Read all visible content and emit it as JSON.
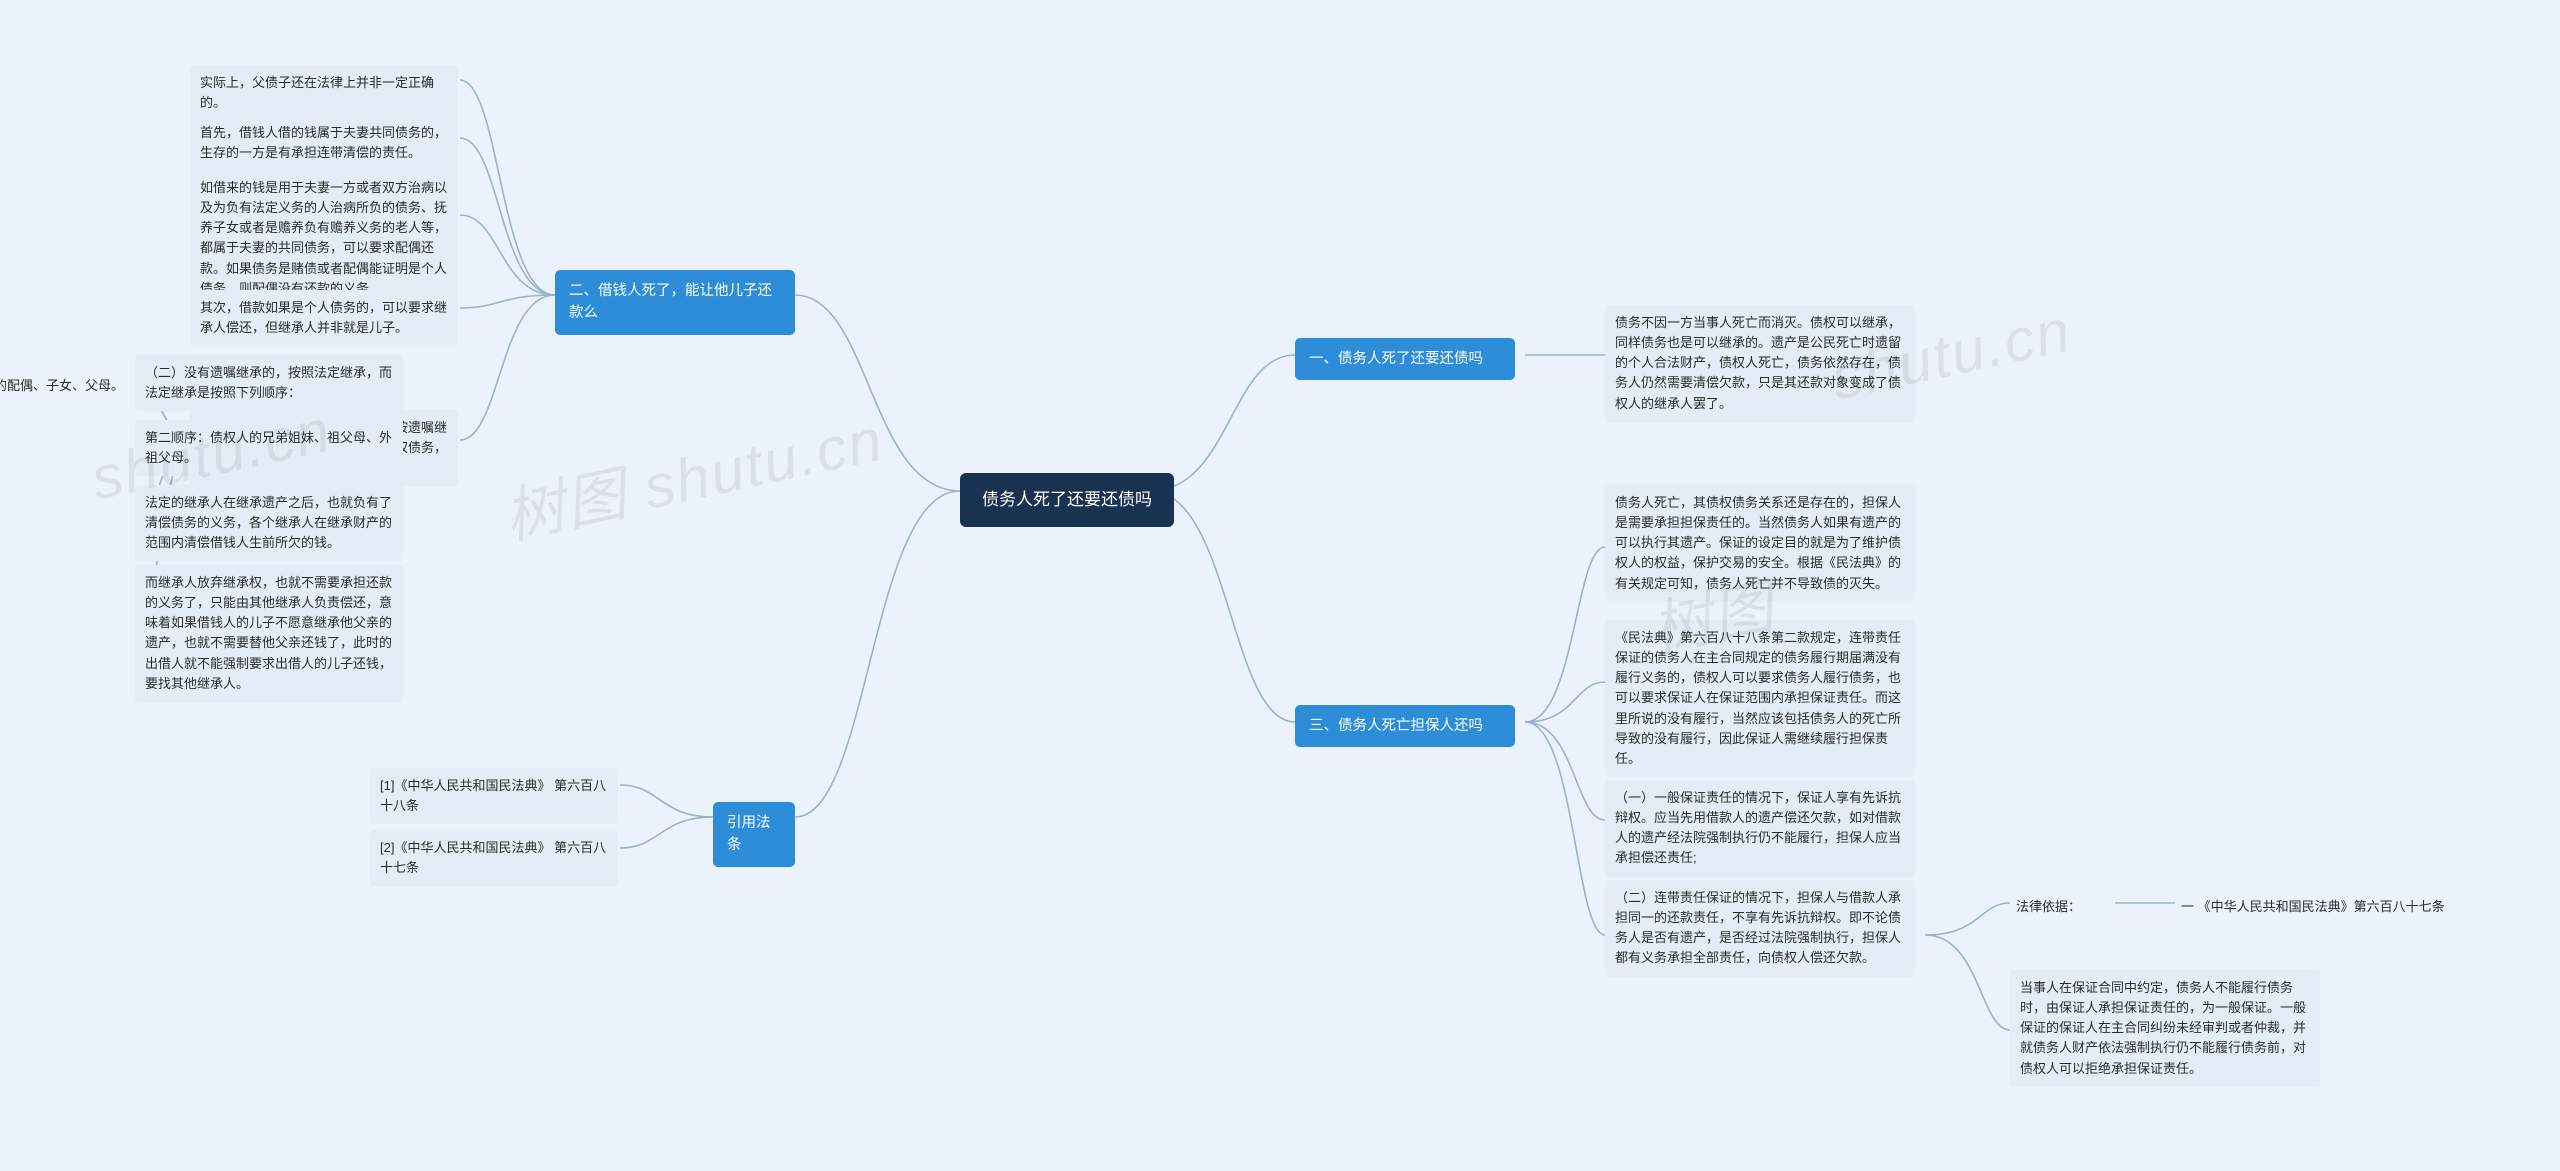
{
  "root": "债务人死了还要还债吗",
  "right": {
    "b1": {
      "title": "一、债务人死了还要还债吗",
      "l1": "债务不因一方当事人死亡而消灭。债权可以继承，同样债务也是可以继承的。遗产是公民死亡时遗留的个人合法财产，债权人死亡，债务依然存在，债务人仍然需要清偿欠款，只是其还款对象变成了债权人的继承人罢了。"
    },
    "b3": {
      "title": "三、债务人死亡担保人还吗",
      "l1": "债务人死亡，其债权债务关系还是存在的，担保人是需要承担担保责任的。当然债务人如果有遗产的可以执行其遗产。保证的设定目的就是为了维护债权人的权益，保护交易的安全。根据《民法典》的有关规定可知，债务人死亡并不导致债的灭失。",
      "l2": "《民法典》第六百八十八条第二款规定，连带责任保证的债务人在主合同规定的债务履行期届满没有履行义务的，债权人可以要求债务人履行债务，也可以要求保证人在保证范围内承担保证责任。而这里所说的没有履行，当然应该包括债务人的死亡所导致的没有履行，因此保证人需继续履行担保责任。",
      "l3": "（一）一般保证责任的情况下，保证人享有先诉抗辩权。应当先用借款人的遗产偿还欠款，如对借款人的遗产经法院强制执行仍不能履行，担保人应当承担偿还责任;",
      "l4": "（二）连带责任保证的情况下，担保人与借款人承担同一的还款责任，不享有先诉抗辩权。即不论债务人是否有遗产，是否经过法院强制执行，担保人都有义务承担全部责任，向债权人偿还欠款。",
      "l4c1_label": "法律依据：",
      "l4c1": "一 《中华人民共和国民法典》第六百八十七条",
      "l4c2": "当事人在保证合同中约定，债务人不能履行债务时，由保证人承担保证责任的，为一般保证。一般保证的保证人在主合同纠纷未经审判或者仲裁，并就债务人财产依法强制执行仍不能履行债务前，对债权人可以拒绝承担保证责任。"
    }
  },
  "left": {
    "b2": {
      "title": "二、借钱人死了，能让他儿子还款么",
      "l1": "实际上，父债子还在法律上并非一定正确的。",
      "l2": "首先，借钱人借的钱属于夫妻共同债务的，生存的一方是有承担连带清偿的责任。",
      "l3": "如借来的钱是用于夫妻一方或者双方治病以及为负有法定义务的人治病所负的债务、抚养子女或者是赡养负有赡养义务的老人等，都属于夫妻的共同债务，可以要求配偶还款。如果债务是赌债或者配偶能证明是个人债务，则配偶没有还款的义务。",
      "l4": "其次，借款如果是个人债务的，可以要求继承人偿还，但继承人并非就是儿子。",
      "l5": {
        "text": "（一）借钱人死亡的，留有遗嘱先按遗嘱继承，遗嘱的继承人就概括继承了债权债务，需要把借款人所欠的钱还上。",
        "sub1": "（二）没有遗嘱继承的，按照法定继承，而法定继承是按照下列顺序：",
        "sub1c": "第一顺序：债权人的配偶、子女、父母。",
        "sub2": "第二顺序：债权人的兄弟姐妹、祖父母、外祖父母。",
        "sub3": "法定的继承人在继承遗产之后，也就负有了清偿债务的义务，各个继承人在继承财产的范围内清偿借钱人生前所欠的钱。",
        "sub4": "而继承人放弃继承权，也就不需要承担还款的义务了，只能由其他继承人负责偿还，意味着如果借钱人的儿子不愿意继承他父亲的遗产，也就不需要替他父亲还钱了，此时的出借人就不能强制要求出借人的儿子还钱，要找其他继承人。"
      }
    },
    "bRef": {
      "title": "引用法条",
      "l1": "[1]《中华人民共和国民法典》 第六百八十八条",
      "l2": "[2]《中华人民共和国民法典》 第六百八十七条"
    }
  },
  "watermarks": [
    "shutu.cn",
    "树图 shutu.cn",
    "shutu.cn",
    "树图"
  ],
  "chart_data": {
    "type": "mindmap",
    "root": "债务人死了还要还债吗",
    "children": [
      {
        "side": "right",
        "label": "一、债务人死了还要还债吗",
        "children": [
          {
            "label": "债务不因一方当事人死亡而消灭。债权可以继承，同样债务也是可以继承的。遗产是公民死亡时遗留的个人合法财产，债权人死亡，债务依然存在，债务人仍然需要清偿欠款，只是其还款对象变成了债权人的继承人罢了。"
          }
        ]
      },
      {
        "side": "right",
        "label": "三、债务人死亡担保人还吗",
        "children": [
          {
            "label": "债务人死亡，其债权债务关系还是存在的，担保人是需要承担担保责任的。当然债务人如果有遗产的可以执行其遗产。保证的设定目的就是为了维护债权人的权益，保护交易的安全。根据《民法典》的有关规定可知，债务人死亡并不导致债的灭失。"
          },
          {
            "label": "《民法典》第六百八十八条第二款规定，连带责任保证的债务人在主合同规定的债务履行期届满没有履行义务的，债权人可以要求债务人履行债务，也可以要求保证人在保证范围内承担保证责任。而这里所说的没有履行，当然应该包括债务人的死亡所导致的没有履行，因此保证人需继续履行担保责任。"
          },
          {
            "label": "（一）一般保证责任的情况下，保证人享有先诉抗辩权。应当先用借款人的遗产偿还欠款，如对借款人的遗产经法院强制执行仍不能履行，担保人应当承担偿还责任;"
          },
          {
            "label": "（二）连带责任保证的情况下，担保人与借款人承担同一的还款责任，不享有先诉抗辩权。即不论债务人是否有遗产，是否经过法院强制执行，担保人都有义务承担全部责任，向债权人偿还欠款。",
            "children": [
              {
                "label": "法律依据：",
                "children": [
                  {
                    "label": "一 《中华人民共和国民法典》第六百八十七条"
                  }
                ]
              },
              {
                "label": "当事人在保证合同中约定，债务人不能履行债务时，由保证人承担保证责任的，为一般保证。一般保证的保证人在主合同纠纷未经审判或者仲裁，并就债务人财产依法强制执行仍不能履行债务前，对债权人可以拒绝承担保证责任。"
              }
            ]
          }
        ]
      },
      {
        "side": "left",
        "label": "二、借钱人死了，能让他儿子还款么",
        "children": [
          {
            "label": "实际上，父债子还在法律上并非一定正确的。"
          },
          {
            "label": "首先，借钱人借的钱属于夫妻共同债务的，生存的一方是有承担连带清偿的责任。"
          },
          {
            "label": "如借来的钱是用于夫妻一方或者双方治病以及为负有法定义务的人治病所负的债务、抚养子女或者是赡养负有赡养义务的老人等，都属于夫妻的共同债务，可以要求配偶还款。如果债务是赌债或者配偶能证明是个人债务，则配偶没有还款的义务。"
          },
          {
            "label": "其次，借款如果是个人债务的，可以要求继承人偿还，但继承人并非就是儿子。"
          },
          {
            "label": "（一）借钱人死亡的，留有遗嘱先按遗嘱继承，遗嘱的继承人就概括继承了债权债务，需要把借款人所欠的钱还上。",
            "children": [
              {
                "label": "（二）没有遗嘱继承的，按照法定继承，而法定继承是按照下列顺序：",
                "children": [
                  {
                    "label": "第一顺序：债权人的配偶、子女、父母。"
                  }
                ]
              },
              {
                "label": "第二顺序：债权人的兄弟姐妹、祖父母、外祖父母。"
              },
              {
                "label": "法定的继承人在继承遗产之后，也就负有了清偿债务的义务，各个继承人在继承财产的范围内清偿借钱人生前所欠的钱。"
              },
              {
                "label": "而继承人放弃继承权，也就不需要承担还款的义务了，只能由其他继承人负责偿还，意味着如果借钱人的儿子不愿意继承他父亲的遗产，也就不需要替他父亲还钱了，此时的出借人就不能强制要求出借人的儿子还钱，要找其他继承人。"
              }
            ]
          }
        ]
      },
      {
        "side": "left",
        "label": "引用法条",
        "children": [
          {
            "label": "[1]《中华人民共和国民法典》 第六百八十八条"
          },
          {
            "label": "[2]《中华人民共和国民法典》 第六百八十七条"
          }
        ]
      }
    ]
  }
}
